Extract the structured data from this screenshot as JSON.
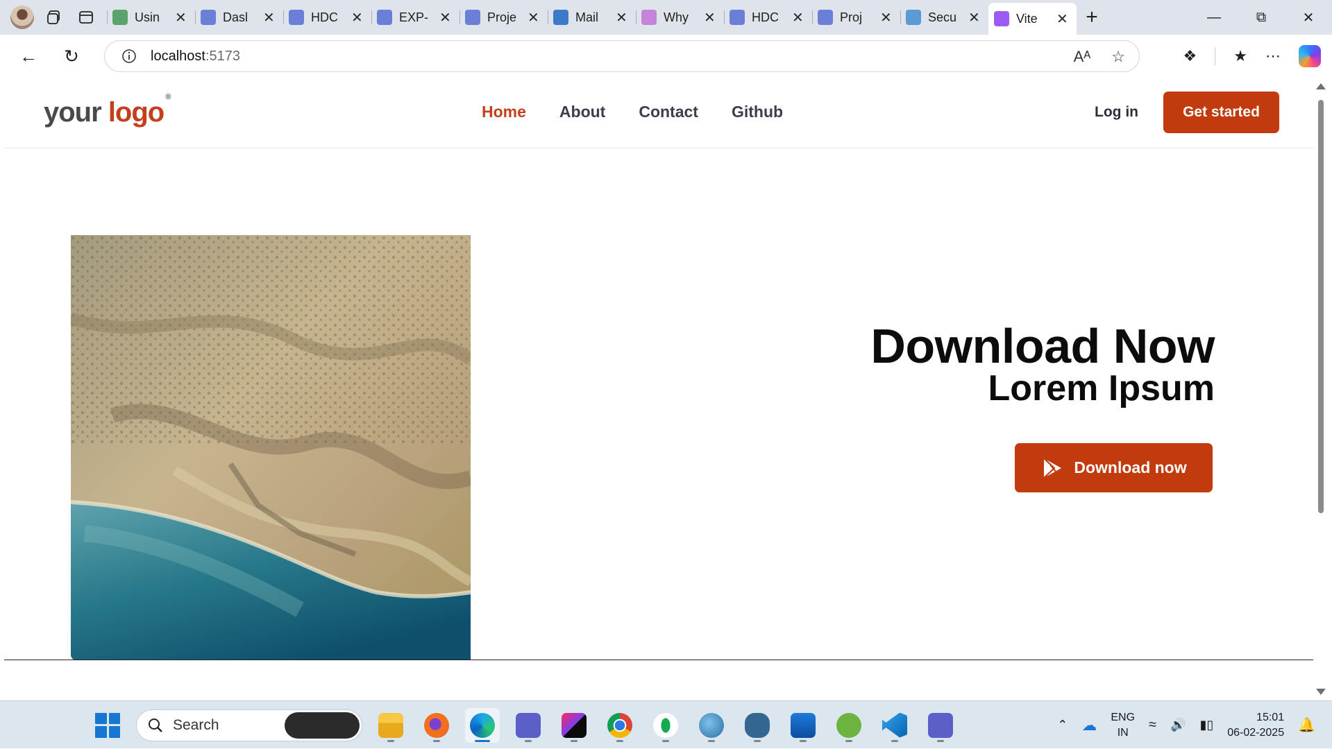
{
  "browser": {
    "tabs": [
      {
        "title": "Usin",
        "favicon": "leaf-icon",
        "color": "#5aa36a"
      },
      {
        "title": "Dasl",
        "favicon": "jira-icon",
        "color": "#6c7fd8"
      },
      {
        "title": "HDC",
        "favicon": "jira-icon",
        "color": "#6c7fd8"
      },
      {
        "title": "EXP-",
        "favicon": "jira-icon",
        "color": "#6c7fd8"
      },
      {
        "title": "Proje",
        "favicon": "jira-icon",
        "color": "#6c7fd8"
      },
      {
        "title": "Mail",
        "favicon": "outlook-icon",
        "color": "#3b7ac6"
      },
      {
        "title": "Why",
        "favicon": "pinwheel-icon",
        "color": "#c583d9"
      },
      {
        "title": "HDC",
        "favicon": "jira-icon",
        "color": "#6c7fd8"
      },
      {
        "title": "Proj",
        "favicon": "jira-icon",
        "color": "#6c7fd8"
      },
      {
        "title": "Secu",
        "favicon": "video-icon",
        "color": "#5b9ad6"
      },
      {
        "title": "Vite",
        "favicon": "vite-icon",
        "color": "#9b5cf4",
        "active": true
      }
    ],
    "url_host": "localhost",
    "url_port": ":5173"
  },
  "site": {
    "logo_part1": "your",
    "logo_part2": "logo",
    "logo_mark": "®",
    "nav": [
      "Home",
      "About",
      "Contact",
      "Github"
    ],
    "active_nav": "Home",
    "login_label": "Log in",
    "cta_label": "Get started",
    "hero_title": "Download Now",
    "hero_subtitle": "Lorem Ipsum",
    "download_button_label": "Download now",
    "accent_color": "#c23b0e"
  },
  "taskbar": {
    "search_label": "Search",
    "language": "ENG",
    "region": "IN",
    "time": "15:01",
    "date": "06-02-2025"
  }
}
